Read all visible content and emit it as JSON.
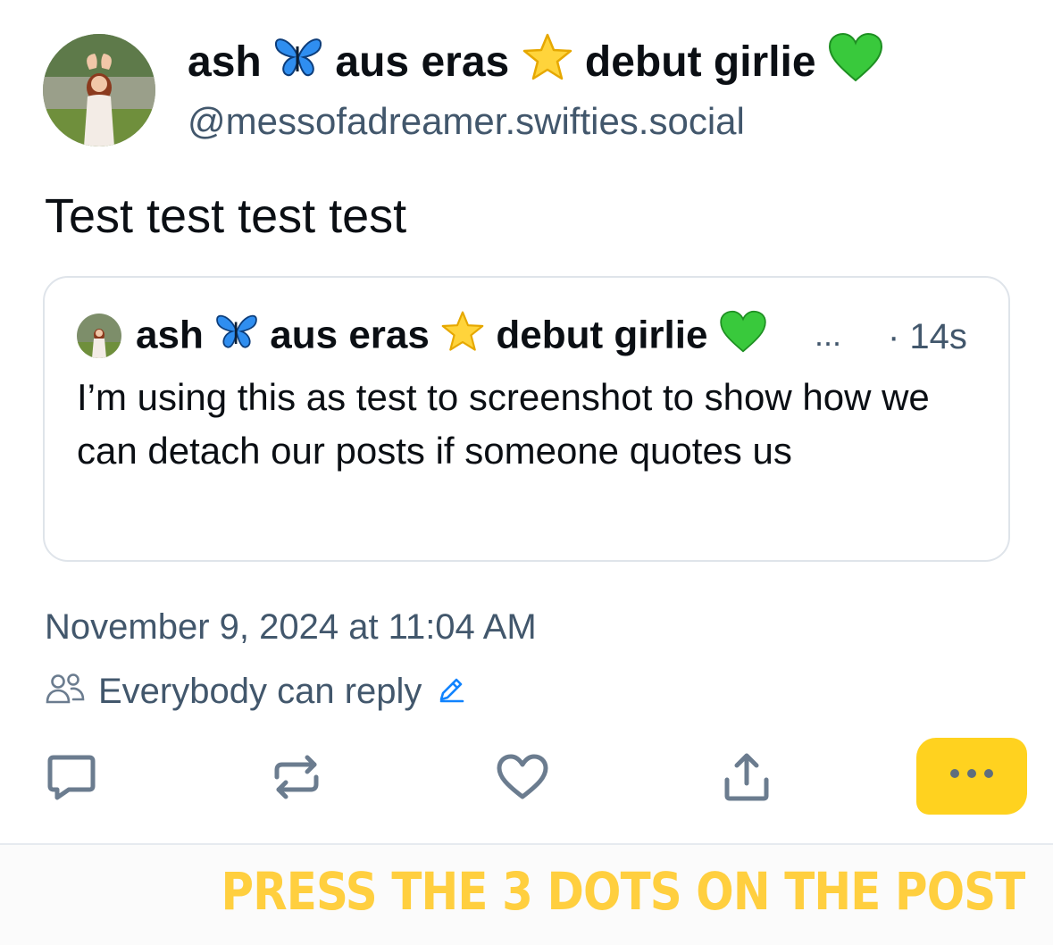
{
  "post": {
    "author": {
      "name_parts": [
        "ash",
        "aus eras",
        "debut girlie"
      ],
      "handle": "@messofadreamer.swifties.social"
    },
    "text": "Test test test test",
    "quote": {
      "author_name_parts": [
        "ash",
        "aus eras",
        "debut girlie"
      ],
      "ellipsis": "...",
      "time": "· 14s",
      "text": "I’m using this as test to screenshot to show how we can detach our posts if someone quotes us"
    },
    "timestamp": "November 9, 2024 at 11:04 AM",
    "reply_setting": "Everybody can reply"
  },
  "icons": {
    "emoji_1": "butterfly-icon",
    "emoji_2": "star-icon",
    "emoji_3": "green-heart-icon",
    "reply": "reply-icon",
    "repost": "repost-icon",
    "like": "heart-icon",
    "share": "share-icon",
    "more": "more-dots-icon"
  },
  "colors": {
    "highlight": "#ffd21f",
    "caption": "#ffcf3f",
    "secondary_text": "#42576c"
  },
  "caption": "PRESS THE 3 DOTS ON THE POST"
}
